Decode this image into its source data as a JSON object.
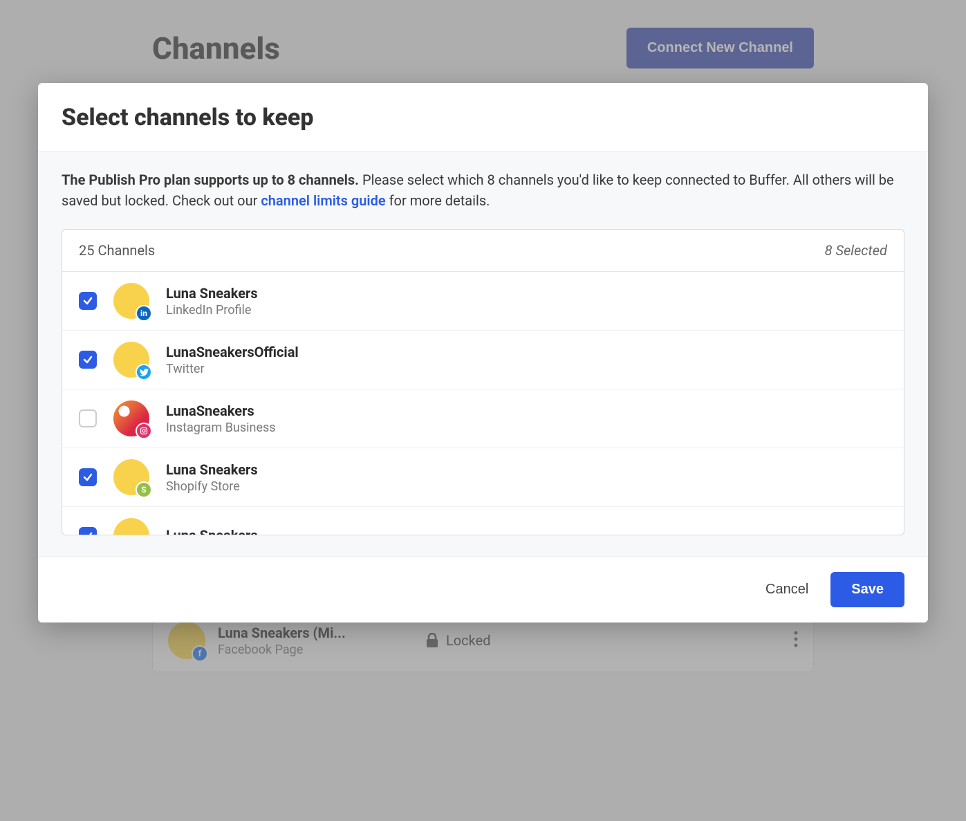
{
  "background": {
    "page_title": "Channels",
    "connect_button": "Connect New Channel",
    "card": {
      "name": "Luna Sneakers (Mi...",
      "subtitle": "Facebook Page",
      "status": "Locked"
    }
  },
  "modal": {
    "title": "Select channels to keep",
    "description": {
      "bold": "The Publish Pro plan supports up to 8 channels.",
      "rest1": " Please select which 8 channels you'd like to keep connected to Buffer. All others will be saved but locked. Check out our ",
      "link": "channel limits guide",
      "rest2": " for more details."
    },
    "list_header": {
      "count_label": "25 Channels",
      "selected_label": "8 Selected"
    },
    "rows": [
      {
        "checked": true,
        "name": "Luna Sneakers",
        "subtitle": "LinkedIn Profile",
        "network": "linkedin"
      },
      {
        "checked": true,
        "name": "LunaSneakersOfficial",
        "subtitle": "Twitter",
        "network": "twitter"
      },
      {
        "checked": false,
        "name": "LunaSneakers",
        "subtitle": "Instagram Business",
        "network": "instagram"
      },
      {
        "checked": true,
        "name": "Luna Sneakers",
        "subtitle": "Shopify Store",
        "network": "shopify"
      },
      {
        "checked": true,
        "name": "Luna Sneakers",
        "subtitle": "",
        "network": "extra"
      }
    ],
    "footer": {
      "cancel": "Cancel",
      "save": "Save"
    }
  }
}
